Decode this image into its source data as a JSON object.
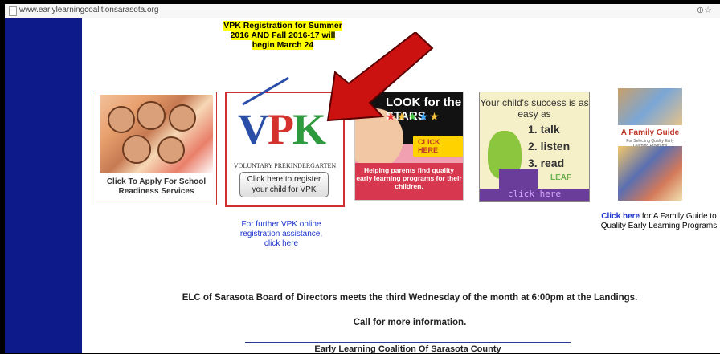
{
  "browser": {
    "url": "www.earlylearningcoalitionsarasota.org"
  },
  "notice": {
    "text": "VPK Registration for Summer 2016 AND Fall 2016-17 will begin March 24"
  },
  "cards": {
    "school_readiness": {
      "caption": "Click To Apply For School Readiness Services"
    },
    "vpk": {
      "logo_v": "V",
      "logo_p": "P",
      "logo_k": "K",
      "subtitle": "VOLUNTARY PREKINDERGARTEN",
      "button": "Click here to register your child for VPK"
    },
    "look_for_stars": {
      "title": "LOOK for the STARS",
      "click": "CLICK HERE",
      "tagline": "Helping parents find quality early learning programs for their children."
    },
    "talk_listen_read": {
      "intro": "Your child's success is as easy as",
      "items": [
        "1. talk",
        "2. listen",
        "3. read"
      ],
      "leaf": "LEAF",
      "click": "click here"
    },
    "family_guide": {
      "title": "A Family Guide",
      "subtitle": "For Selecting Quality Early Learning Programs"
    }
  },
  "vpk_assist": "For further VPK online registration assistance, click here",
  "guide_link": {
    "link": "Click here",
    "text": " for A Family Guide to Quality Early Learning Programs"
  },
  "board_notice": "ELC of Sarasota Board of Directors meets the third Wednesday of the month at 6:00pm at the Landings.",
  "call_notice": "Call for more information.",
  "org_name": "Early Learning Coalition Of Sarasota County",
  "colors": {
    "sidebar": "#0c1a8a",
    "link": "#1a33cc",
    "highlight": "#ffff00",
    "arrow": "#cc1111"
  }
}
